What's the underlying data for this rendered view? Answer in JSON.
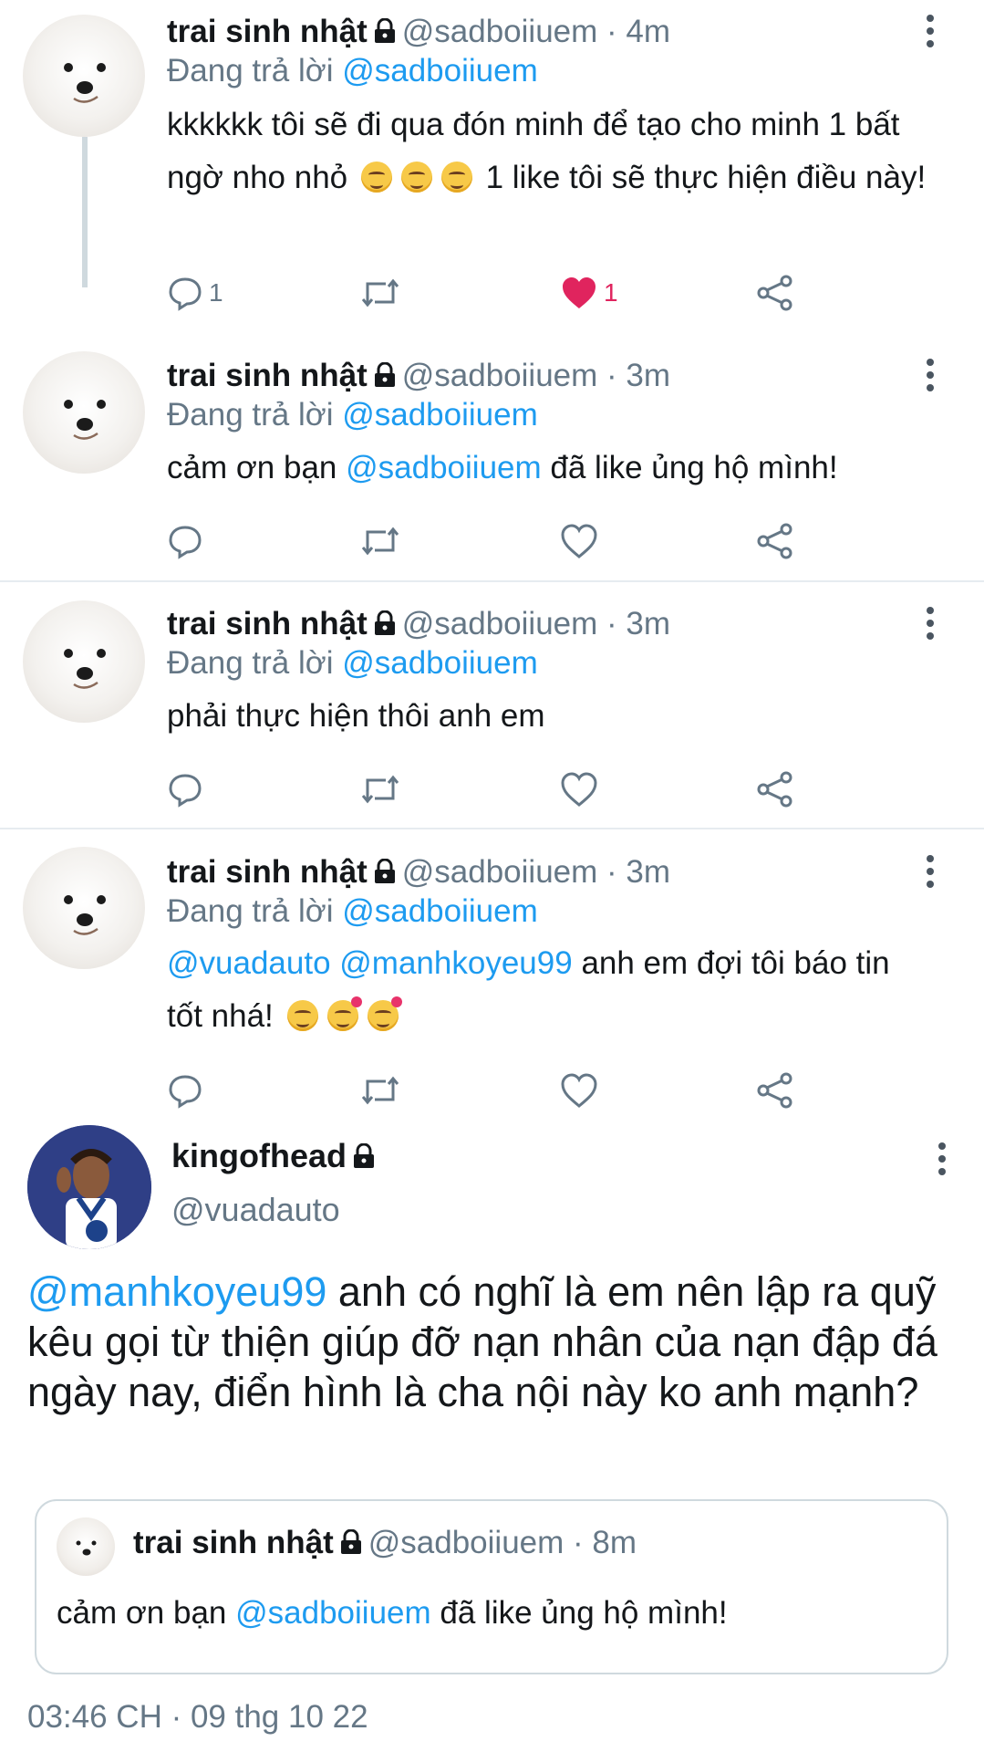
{
  "colors": {
    "accent": "#1d9bf0",
    "muted": "#657786",
    "like": "#e0245e",
    "text": "#14171a"
  },
  "replies": [
    {
      "name": "trai sinh nhật",
      "handle": "@sadboiiuem",
      "time": "· 4m",
      "reply_prefix": "Đang trả lời",
      "reply_to": "@sadboiiuem",
      "text_a": "kkkkkk tôi sẽ đi qua đón minh để tạo cho minh 1 bất ngờ nho nhỏ",
      "text_b": "1 like tôi sẽ thực hiện điều này!",
      "reply_count": "1",
      "like_count": "1",
      "liked": true
    },
    {
      "name": "trai sinh nhật",
      "handle": "@sadboiiuem",
      "time": "· 3m",
      "reply_prefix": "Đang trả lời",
      "reply_to": "@sadboiiuem",
      "text_a": "cảm ơn bạn",
      "text_mention": "@sadboiiuem",
      "text_b": "đã like ủng hộ mình!"
    },
    {
      "name": "trai sinh nhật",
      "handle": "@sadboiiuem",
      "time": "· 3m",
      "reply_prefix": "Đang trả lời",
      "reply_to": "@sadboiiuem",
      "text_a": "phải thực hiện thôi anh em"
    },
    {
      "name": "trai sinh nhật",
      "handle": "@sadboiiuem",
      "time": "· 3m",
      "reply_prefix": "Đang trả lời",
      "reply_to": "@sadboiiuem",
      "mention_1": "@vuadauto",
      "mention_2": "@manhkoyeu99",
      "text_a": "anh em đợi tôi báo tin tốt nhá!"
    }
  ],
  "main_tweet": {
    "name": "kingofhead",
    "handle": "@vuadauto",
    "mention": "@manhkoyeu99",
    "text": "anh có nghĩ là em nên lập ra quỹ kêu gọi từ thiện giúp đỡ nạn nhân của nạn đập đá ngày nay, điển hình là cha nội này ko anh mạnh?",
    "quote": {
      "name": "trai sinh nhật",
      "handle": "@sadboiiuem",
      "time": "· 8m",
      "text_a": "cảm ơn bạn",
      "text_mention": "@sadboiiuem",
      "text_b": "đã like ủng hộ mình!"
    },
    "timestamp": "03:46 CH · 09 thg 10 22"
  },
  "icons": [
    "lock-icon",
    "more-icon",
    "reply-icon",
    "retweet-icon",
    "like-icon",
    "share-icon"
  ]
}
